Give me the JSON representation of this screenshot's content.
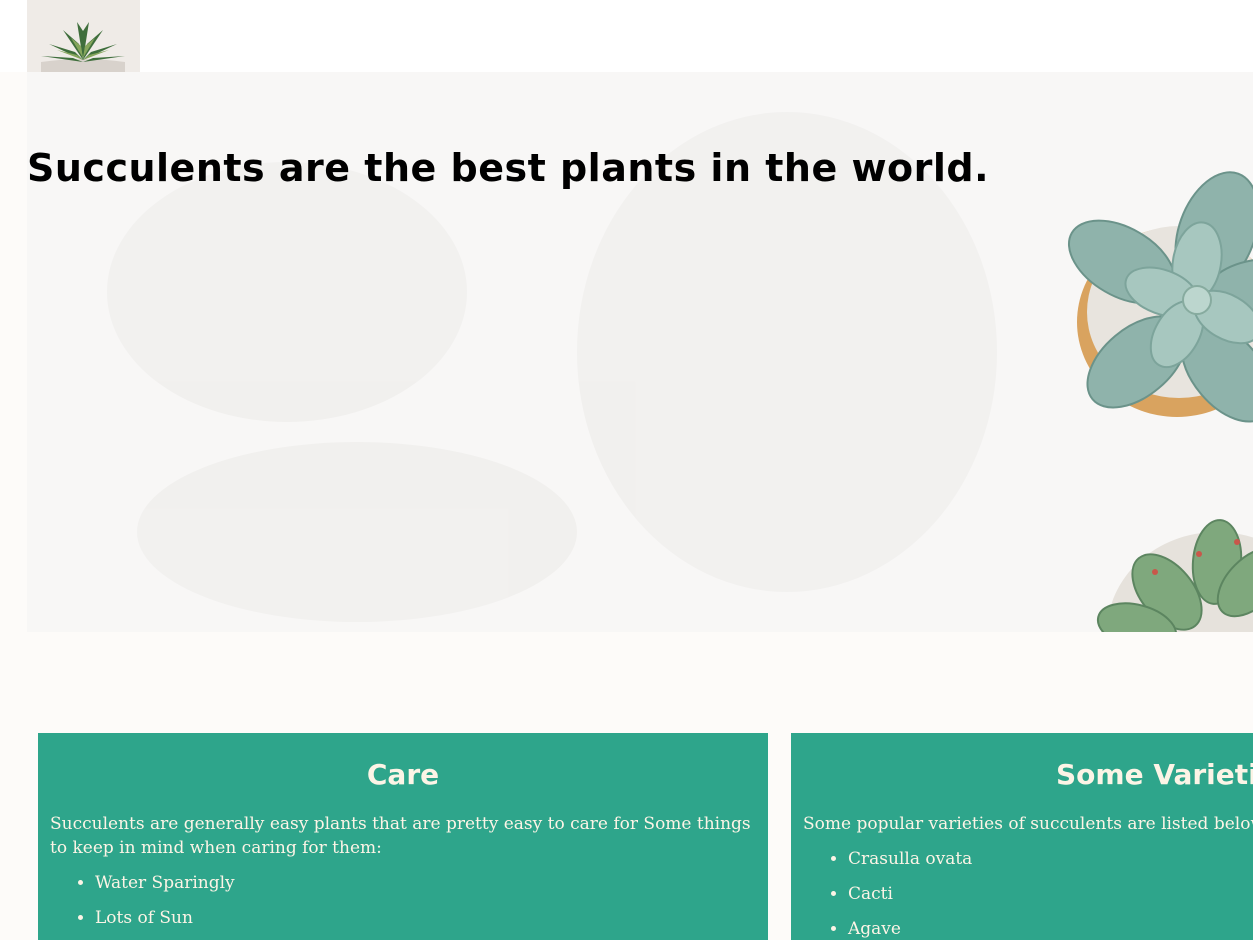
{
  "header": {
    "logo_icon": "succulent-logo-icon"
  },
  "hero": {
    "title": "Succulents are the best plants in the world.",
    "image_icon": "succulent-plants-photo"
  },
  "care": {
    "heading": "Care",
    "text": "Succulents are generally easy plants that are pretty easy to care for Some things to keep in mind when caring for them:",
    "items": [
      "Water Sparingly",
      "Lots of Sun"
    ]
  },
  "varieties": {
    "heading": "Some Varieties",
    "text": "Some popular varieties of succulents are listed below:",
    "items": [
      "Crasulla ovata",
      "Cacti",
      "Agave"
    ]
  },
  "colors": {
    "card_bg": "#2ea58b",
    "card_text": "#fcf4e6",
    "page_bg": "#fdfbf9"
  }
}
